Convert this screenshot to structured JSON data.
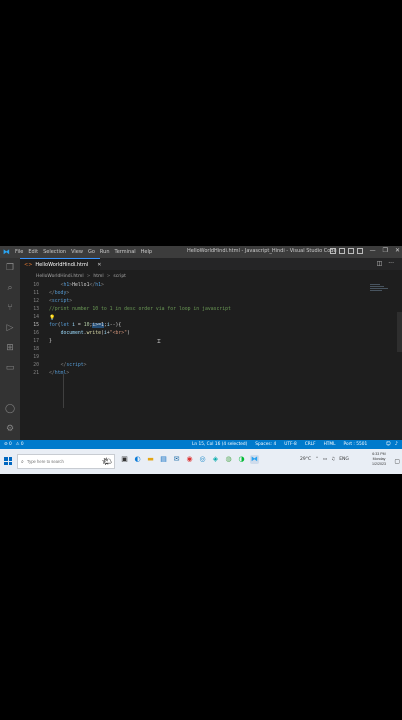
{
  "window": {
    "title": "HelloWorldHindi.html - Javascript_Hindi - Visual Studio Code",
    "menu": [
      "File",
      "Edit",
      "Selection",
      "View",
      "Go",
      "Run",
      "Terminal",
      "Help"
    ],
    "controls": {
      "minimize": "—",
      "maximize": "❐",
      "close": "✕"
    }
  },
  "activity_bar": [
    "explorer-icon",
    "search-icon",
    "source-control-icon",
    "run-debug-icon",
    "extensions-icon",
    "remote-icon",
    "account-icon",
    "settings-gear-icon"
  ],
  "tab": {
    "label": "HelloWorldHindi.html",
    "icon_glyph": "<>",
    "close": "✕"
  },
  "editor_actions": {
    "split": "◫",
    "more": "···"
  },
  "breadcrumb": {
    "file": "HelloWorldHindi.html",
    "node1": "html",
    "node2": "script",
    "sep": ">"
  },
  "code_lines": [
    {
      "n": "10",
      "parts": [
        [
          "txt",
          "    "
        ],
        [
          "br",
          "<"
        ],
        [
          "tag",
          "h1"
        ],
        [
          "br",
          ">"
        ],
        [
          "txt",
          "Hello1"
        ],
        [
          "br",
          "</"
        ],
        [
          "tag",
          "h1"
        ],
        [
          "br",
          ">"
        ]
      ]
    },
    {
      "n": "11",
      "parts": [
        [
          "br",
          "</"
        ],
        [
          "tag",
          "body"
        ],
        [
          "br",
          ">"
        ]
      ]
    },
    {
      "n": "12",
      "parts": [
        [
          "br",
          "<"
        ],
        [
          "tag",
          "script"
        ],
        [
          "br",
          ">"
        ]
      ]
    },
    {
      "n": "13",
      "parts": [
        [
          "cmt",
          "//print number 10 to 1 in desc order via for loop in javascript"
        ]
      ]
    },
    {
      "n": "14",
      "parts": [
        [
          "bulb",
          "💡"
        ]
      ]
    },
    {
      "n": "15",
      "parts": [
        [
          "kw",
          "for"
        ],
        [
          "txt",
          "("
        ],
        [
          "kw",
          "let"
        ],
        [
          "var",
          " i"
        ],
        [
          "txt",
          " = "
        ],
        [
          "num",
          "10"
        ],
        [
          "txt",
          ";"
        ],
        [
          "sel",
          "i>=1"
        ],
        [
          "txt",
          ";"
        ],
        [
          "var",
          "i"
        ],
        [
          "txt",
          "--){"
        ]
      ]
    },
    {
      "n": "16",
      "parts": [
        [
          "txt",
          "    "
        ],
        [
          "var",
          "document"
        ],
        [
          "txt",
          "."
        ],
        [
          "fn",
          "write"
        ],
        [
          "txt",
          "("
        ],
        [
          "var",
          "i"
        ],
        [
          "txt",
          "+"
        ],
        [
          "str",
          "\"<br>\""
        ],
        [
          "txt",
          ")"
        ]
      ]
    },
    {
      "n": "17",
      "parts": [
        [
          "txt",
          "}"
        ]
      ]
    },
    {
      "n": "18",
      "parts": []
    },
    {
      "n": "19",
      "parts": []
    },
    {
      "n": "20",
      "parts": [
        [
          "txt",
          "    "
        ],
        [
          "br",
          "</"
        ],
        [
          "tag",
          "script"
        ],
        [
          "br",
          ">"
        ]
      ]
    },
    {
      "n": "21",
      "parts": [
        [
          "br",
          "</"
        ],
        [
          "tag",
          "html"
        ],
        [
          "br",
          ">"
        ]
      ]
    }
  ],
  "current_line": "15",
  "status": {
    "remote": "⊘ 0",
    "warnings": "⚠ 0",
    "position": "Ln 15, Col 16 (4 selected)",
    "spaces": "Spaces: 4",
    "encoding": "UTF-8",
    "eol": "CRLF",
    "language": "HTML",
    "port": "Port : 5501"
  },
  "taskbar": {
    "search_placeholder": "Type here to search",
    "clock_time": "6:33 PM",
    "clock_day": "Monday",
    "clock_date": "1/2/2023",
    "lang": "ENG",
    "temp": "29°C"
  }
}
